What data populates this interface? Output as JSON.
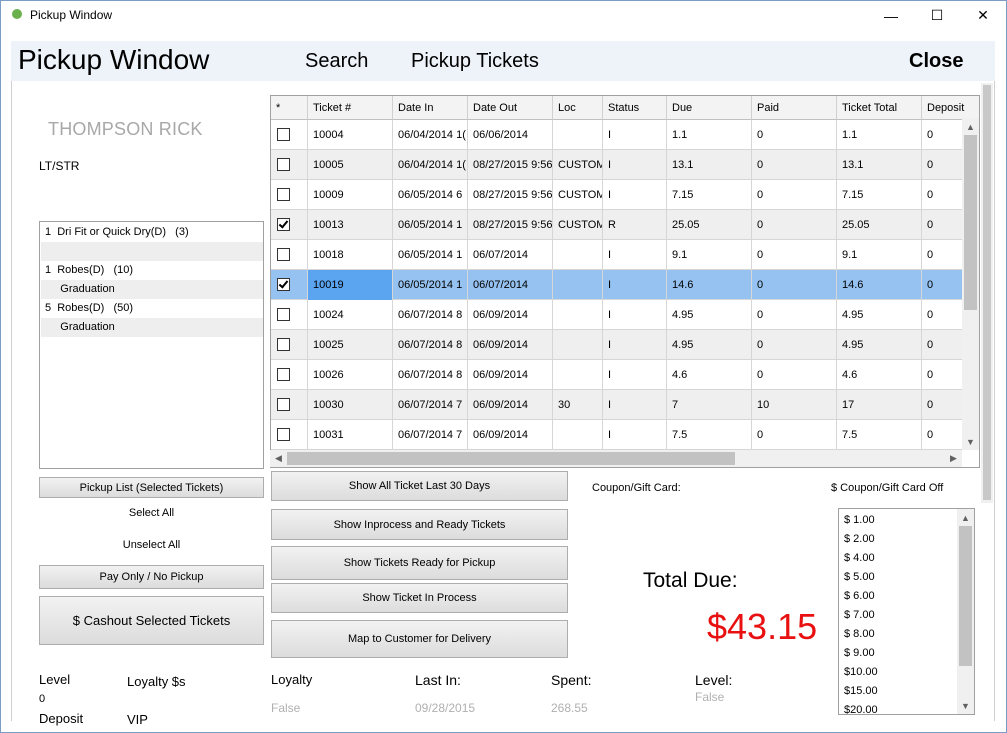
{
  "window": {
    "title": "Pickup Window",
    "min": "—",
    "max": "☐",
    "close": "✕"
  },
  "header": {
    "title": "Pickup Window",
    "search": "Search",
    "pickup_tickets": "Pickup Tickets",
    "close": "Close"
  },
  "customer": {
    "name": "THOMPSON RICK",
    "type": "LT/STR"
  },
  "items": [
    {
      "text": "1  Dri Fit or Quick Dry(D)   (3)",
      "alt": false
    },
    {
      "text": "",
      "alt": true
    },
    {
      "text": "1  Robes(D)   (10)",
      "alt": false
    },
    {
      "text": "     Graduation",
      "alt": true
    },
    {
      "text": "5  Robes(D)   (50)",
      "alt": false
    },
    {
      "text": "     Graduation",
      "alt": true
    }
  ],
  "left_actions": {
    "pickup_list": "Pickup List (Selected Tickets)",
    "select_all": "Select All",
    "unselect_all": "Unselect All",
    "pay_only": "Pay Only / No Pickup",
    "cashout": "$ Cashout Selected Tickets"
  },
  "grid": {
    "headers": [
      "*",
      "Ticket #",
      "Date In",
      "Date Out",
      "Loc",
      "Status",
      "Due",
      "Paid",
      "Ticket Total",
      "Deposit"
    ],
    "rows": [
      {
        "checked": false,
        "selected": false,
        "cells": [
          "10004",
          "06/04/2014 1(",
          "06/06/2014",
          "",
          "I",
          "1.1",
          "0",
          "1.1",
          "0"
        ]
      },
      {
        "checked": false,
        "selected": false,
        "cells": [
          "10005",
          "06/04/2014 1(",
          "08/27/2015 9:56",
          "CUSTOM",
          "I",
          "13.1",
          "0",
          "13.1",
          "0"
        ]
      },
      {
        "checked": false,
        "selected": false,
        "cells": [
          "10009",
          "06/05/2014 6",
          "08/27/2015 9:56",
          "CUSTOM",
          "I",
          "7.15",
          "0",
          "7.15",
          "0"
        ]
      },
      {
        "checked": true,
        "selected": false,
        "cells": [
          "10013",
          "06/05/2014 1",
          "08/27/2015 9:56",
          "CUSTOM",
          "R",
          "25.05",
          "0",
          "25.05",
          "0"
        ]
      },
      {
        "checked": false,
        "selected": false,
        "cells": [
          "10018",
          "06/05/2014 1",
          "06/07/2014",
          "",
          "I",
          "9.1",
          "0",
          "9.1",
          "0"
        ]
      },
      {
        "checked": true,
        "selected": true,
        "cells": [
          "10019",
          "06/05/2014 1",
          "06/07/2014",
          "",
          "I",
          "14.6",
          "0",
          "14.6",
          "0"
        ]
      },
      {
        "checked": false,
        "selected": false,
        "cells": [
          "10024",
          "06/07/2014 8",
          "06/09/2014",
          "",
          "I",
          "4.95",
          "0",
          "4.95",
          "0"
        ]
      },
      {
        "checked": false,
        "selected": false,
        "cells": [
          "10025",
          "06/07/2014 8",
          "06/09/2014",
          "",
          "I",
          "4.95",
          "0",
          "4.95",
          "0"
        ]
      },
      {
        "checked": false,
        "selected": false,
        "cells": [
          "10026",
          "06/07/2014 8",
          "06/09/2014",
          "",
          "I",
          "4.6",
          "0",
          "4.6",
          "0"
        ]
      },
      {
        "checked": false,
        "selected": false,
        "cells": [
          "10030",
          "06/07/2014 7",
          "06/09/2014",
          "30",
          "I",
          "7",
          "10",
          "17",
          "0"
        ]
      },
      {
        "checked": false,
        "selected": false,
        "cells": [
          "10031",
          "06/07/2014 7",
          "06/09/2014",
          "",
          "I",
          "7.5",
          "0",
          "7.5",
          "0"
        ]
      }
    ]
  },
  "filters": {
    "last30": "Show All Ticket Last 30 Days",
    "inprocess_ready": "Show Inprocess and Ready Tickets",
    "ready": "Show Tickets Ready for Pickup",
    "inprocess": "Show Ticket In Process",
    "map": "Map to Customer for Delivery"
  },
  "coupon": {
    "label": "Coupon/Gift Card:",
    "off_label": "$ Coupon/Gift Card Off",
    "amounts": [
      "$ 1.00",
      "$ 2.00",
      "$ 4.00",
      "$ 5.00",
      "$ 6.00",
      "$ 7.00",
      "$ 8.00",
      "$ 9.00",
      "$10.00",
      "$15.00",
      "$20.00"
    ]
  },
  "total": {
    "label": "Total Due:",
    "amount": "$43.15",
    "color": "#e81010"
  },
  "stats": {
    "level_label": "Level",
    "level_value": "0",
    "loyalty_dollars_label": "Loyalty $s",
    "deposit_label": "Deposit",
    "vip_label": "VIP",
    "loyalty_label": "Loyalty",
    "loyalty_value": "False",
    "last_in_label": "Last In:",
    "last_in_value": "09/28/2015",
    "spent_label": "Spent:",
    "spent_value": "268.55",
    "level2_label": "Level:",
    "level2_value": "False"
  }
}
